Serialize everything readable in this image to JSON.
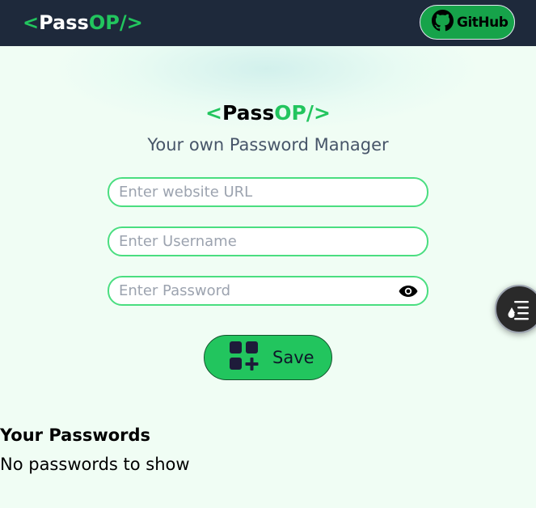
{
  "brand": {
    "open_bracket": "<",
    "pass": "Pass",
    "op": "OP/",
    "close_bracket": ">"
  },
  "navbar": {
    "github_label": "GitHub",
    "github_icon": "github-icon"
  },
  "hero": {
    "subtitle": "Your own Password Manager"
  },
  "form": {
    "url_placeholder": "Enter website URL",
    "username_placeholder": "Enter Username",
    "password_placeholder": "Enter Password",
    "url_value": "",
    "username_value": "",
    "password_value": "",
    "show_password_icon": "eye-icon",
    "save_label": "Save",
    "save_icon": "add-grid-icon"
  },
  "passwords": {
    "title": "Your Passwords",
    "empty_message": "No passwords to show"
  },
  "floating_widget": {
    "icon": "shapes-list-icon"
  },
  "colors": {
    "navbar_bg": "#1e293b",
    "accent_green": "#22c55e",
    "page_bg": "#f0fdf4",
    "input_border": "#4ade80"
  }
}
